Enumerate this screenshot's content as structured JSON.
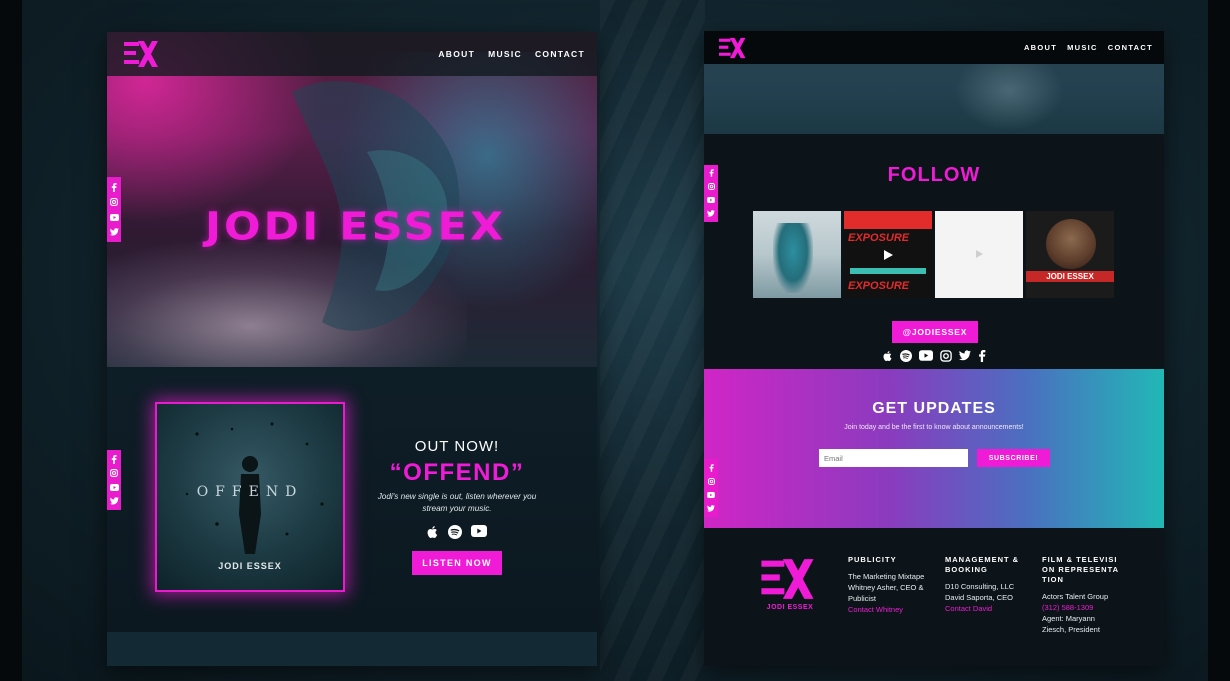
{
  "colors": {
    "accent": "#f01bd6",
    "dark_bg": "#0c1419"
  },
  "nav": {
    "logo_icon": "ex-logo-icon",
    "about": "ABOUT",
    "music": "MUSIC",
    "contact": "CONTACT"
  },
  "social_rail": [
    "facebook-icon",
    "instagram-icon",
    "youtube-icon",
    "twitter-icon"
  ],
  "hero": {
    "artist_name": "JODI ESSEX"
  },
  "release": {
    "album_cover_title": "OFFEND",
    "album_cover_artist": "JODI ESSEX",
    "out_now": "OUT NOW!",
    "song_title": "“OFFEND”",
    "description": "Jodi's new single is out, listen wherever you stream your music.",
    "stream_icons": [
      "apple-icon",
      "spotify-icon",
      "youtube-icon"
    ],
    "listen_button": "LISTEN NOW"
  },
  "follow": {
    "title": "FOLLOW",
    "tiles": [
      {
        "name": "photo-tile-1"
      },
      {
        "name": "photo-tile-2",
        "labels": [
          "EXPOSURE",
          "EXPOSURE"
        ]
      },
      {
        "name": "photo-tile-3"
      },
      {
        "name": "photo-tile-4",
        "labels": [
          "JODI ESSEX"
        ]
      }
    ],
    "handle": "@JODIESSEX",
    "icons": [
      "apple-icon",
      "spotify-icon",
      "youtube-icon",
      "instagram-icon",
      "twitter-icon",
      "facebook-icon"
    ]
  },
  "updates": {
    "title": "GET UPDATES",
    "subtitle": "Join today and be the first to know about announcements!",
    "email_placeholder": "Email",
    "subscribe_button": "SUBSCRIBE!"
  },
  "footer": {
    "logo_text": "JODI ESSEX",
    "publicity": {
      "heading": "PUBLICITY",
      "lines": [
        "The Marketing Mixtape",
        "Whitney Asher, CEO & Publicist"
      ],
      "link": "Contact Whitney"
    },
    "management": {
      "heading": "MANAGEMENT & BOOKING",
      "lines": [
        "D10 Consulting, LLC",
        "David Saporta, CEO"
      ],
      "link": "Contact David"
    },
    "film": {
      "heading": "FILM & TELEVISION REPRESENTATION",
      "lines": [
        "Actors Talent Group"
      ],
      "phone": "(312) 588-1309",
      "agent_lines": [
        "Agent: Maryann Ziesch, President"
      ]
    }
  }
}
